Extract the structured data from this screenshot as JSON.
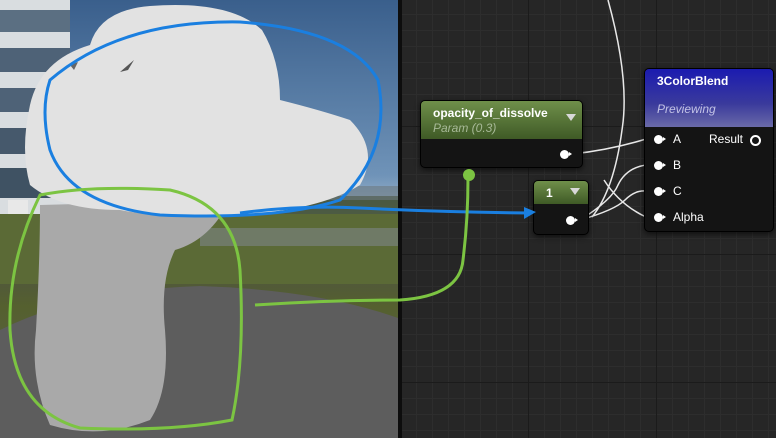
{
  "nodes": {
    "param": {
      "title": "opacity_of_dissolve",
      "subtitle": "Param (0.3)"
    },
    "constant": {
      "title": "1"
    },
    "blend": {
      "title": "3ColorBlend",
      "status": "Previewing",
      "inputs": [
        "A",
        "B",
        "C",
        "Alpha"
      ],
      "output": "Result"
    }
  },
  "colors": {
    "graph_background": "#262626",
    "param_header": "#5d7a3c",
    "blend_header": "#2a2a9a",
    "annotation_blue": "#1a7fe0",
    "annotation_green": "#7cc442"
  },
  "icons": [
    "dropdown-arrow-icon",
    "output-pin-icon",
    "input-pin-icon",
    "result-pin-icon"
  ]
}
